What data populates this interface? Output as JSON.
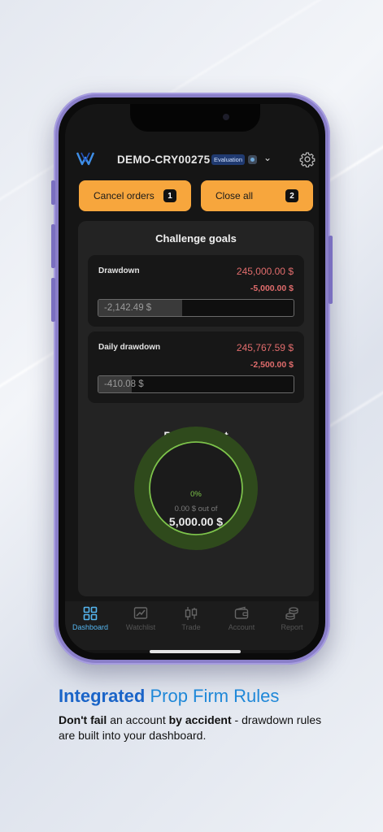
{
  "header": {
    "account_id": "DEMO-CRY00275",
    "badge": "Evaluation"
  },
  "actions": {
    "cancel_label": "Cancel orders",
    "cancel_count": "1",
    "close_label": "Close all",
    "close_count": "2"
  },
  "challenge": {
    "title": "Challenge goals",
    "goals": [
      {
        "label": "Drawdown",
        "limit": "245,000.00 $",
        "delta": "-5,000.00 $",
        "current": "-2,142.49 $",
        "fill_fraction": 0.43
      },
      {
        "label": "Daily drawdown",
        "limit": "245,767.59 $",
        "delta": "-2,500.00 $",
        "current": "-410.08 $",
        "fill_fraction": 0.17
      }
    ]
  },
  "profit_target": {
    "title": "Profit target",
    "percent": "0%",
    "progress_text": "0.00 $ out of",
    "target": "5,000.00 $",
    "progress_fraction": 0
  },
  "tabs": [
    {
      "label": "Dashboard",
      "icon": "dashboard-icon",
      "active": true
    },
    {
      "label": "Watchlist",
      "icon": "chart-trend-icon",
      "active": false
    },
    {
      "label": "Trade",
      "icon": "candlestick-icon",
      "active": false
    },
    {
      "label": "Account",
      "icon": "wallet-icon",
      "active": false
    },
    {
      "label": "Report",
      "icon": "coins-stack-icon",
      "active": false
    }
  ],
  "caption": {
    "title_bold": "Integrated",
    "title_rest": " Prop Firm Rules",
    "body_bold1": "Don't fail",
    "body_text1": " an account ",
    "body_bold2": "by accident",
    "body_text2": " - drawdown rules are built into your dashboard."
  },
  "colors": {
    "accent_orange": "#f7a63d",
    "loss_red": "#e06c6c",
    "profit_green": "#7dc44a",
    "active_tab_blue": "#55b6f0"
  }
}
